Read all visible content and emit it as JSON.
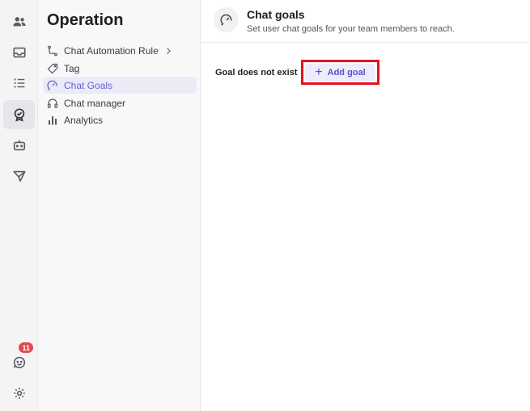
{
  "rail": {
    "items": [
      {
        "name": "team-icon"
      },
      {
        "name": "inbox-icon"
      },
      {
        "name": "list-icon"
      },
      {
        "name": "operation-icon"
      },
      {
        "name": "bot-icon"
      },
      {
        "name": "send-icon"
      }
    ],
    "notifications_badge": "11"
  },
  "sidebar": {
    "title": "Operation",
    "items": [
      {
        "label": "Chat Automation Rule",
        "icon": "flow-icon"
      },
      {
        "label": "Tag",
        "icon": "tag-icon"
      },
      {
        "label": "Chat Goals",
        "icon": "goal-icon"
      },
      {
        "label": "Chat manager",
        "icon": "headset-icon"
      },
      {
        "label": "Analytics",
        "icon": "chart-icon"
      }
    ]
  },
  "header": {
    "title": "Chat goals",
    "subtitle": "Set user chat goals for your team members to reach."
  },
  "main": {
    "empty_text": "Goal does not exist",
    "add_label": "Add goal",
    "add_plus": "+"
  },
  "colors": {
    "accent": "#5a4fcf",
    "highlight": "#e0141e",
    "badge": "#e5484d"
  }
}
